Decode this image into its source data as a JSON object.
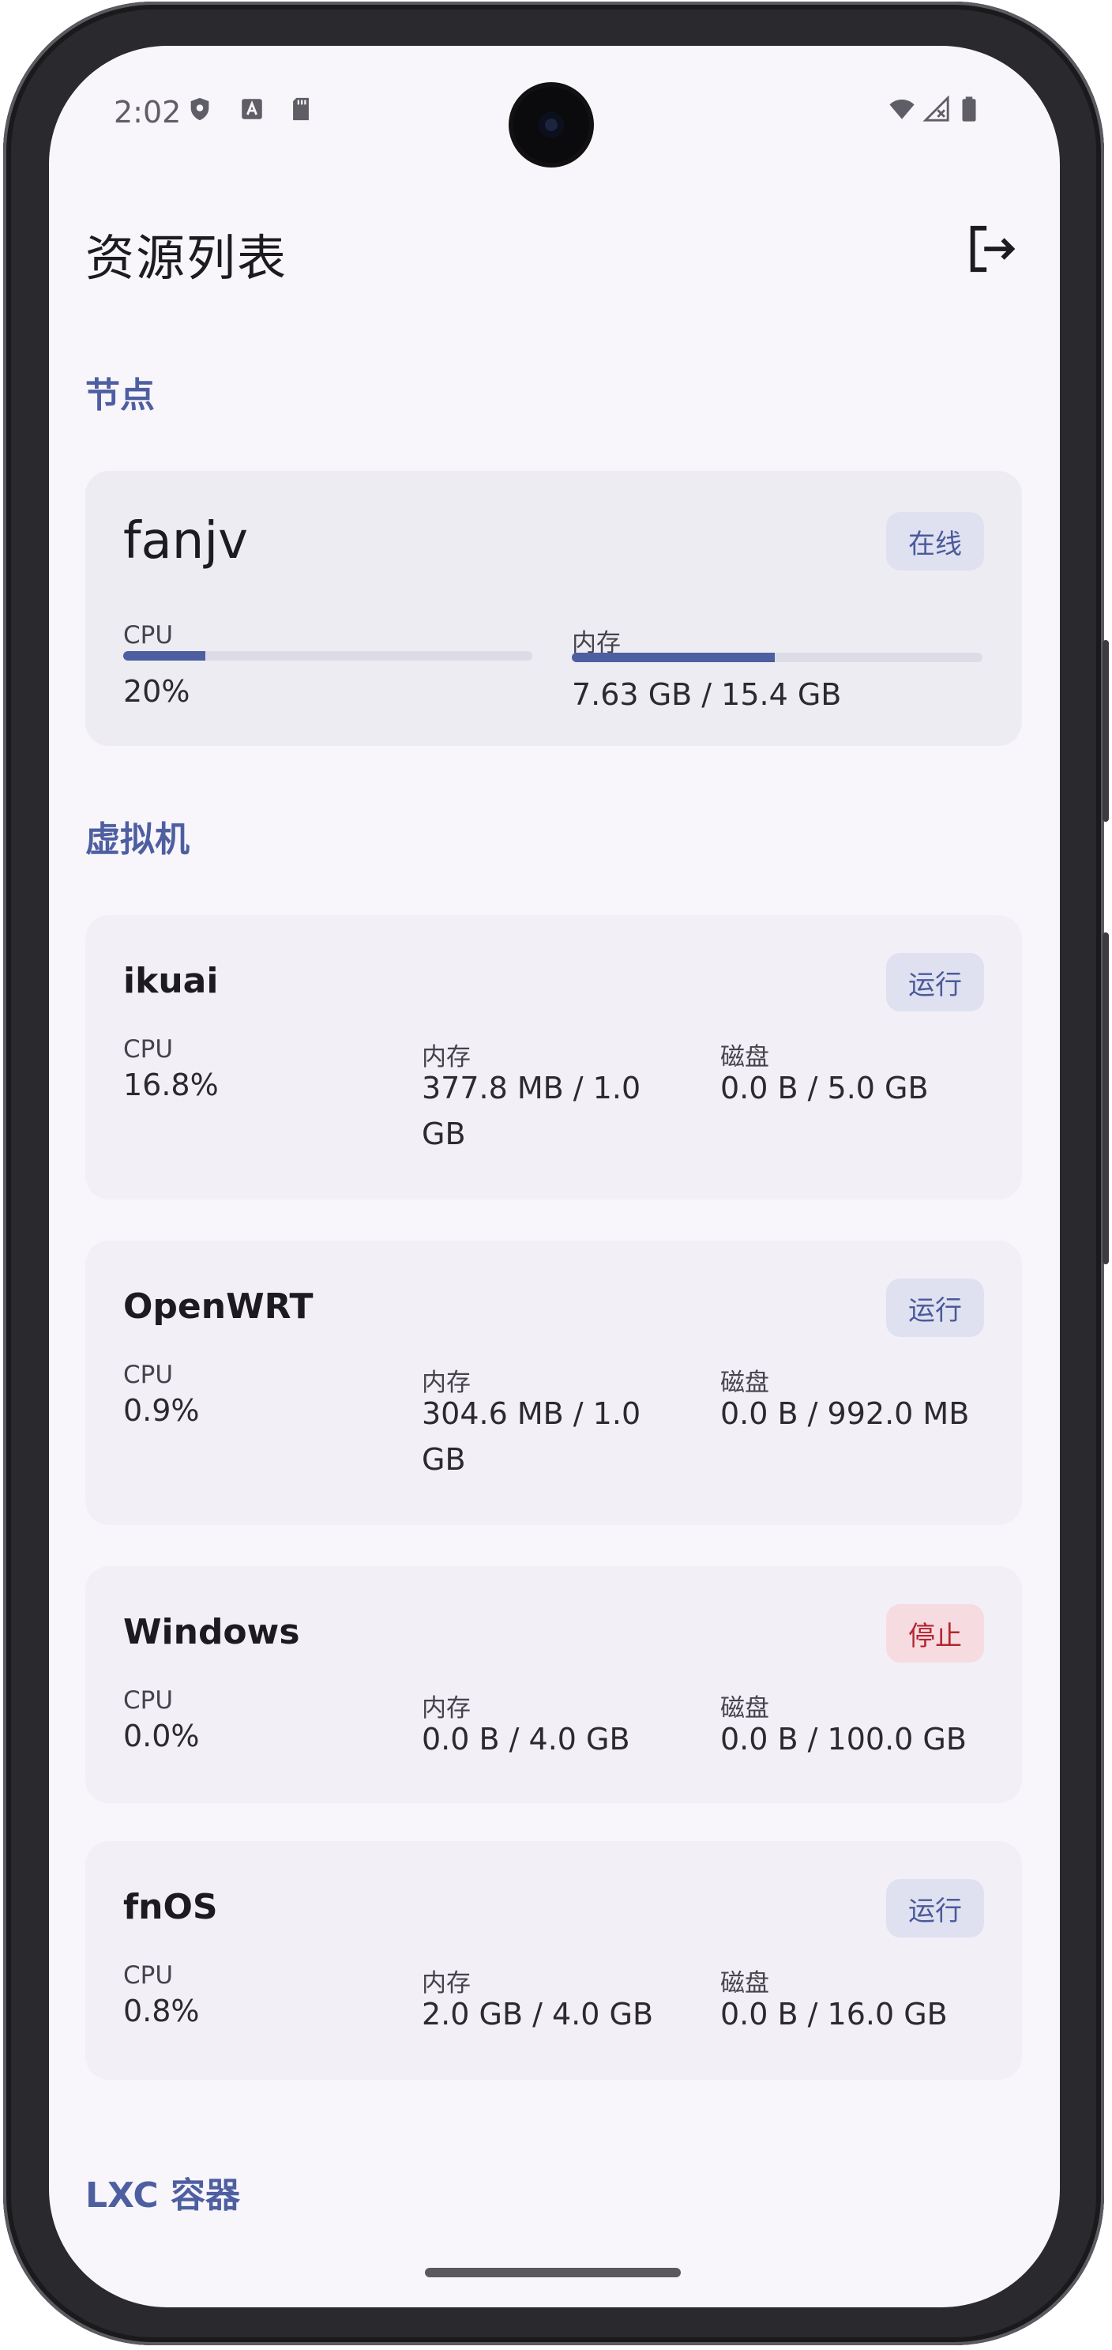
{
  "status_bar": {
    "time": "2:02",
    "icons": [
      "shield-icon",
      "text-a-icon",
      "sd-card-icon",
      "wifi-icon",
      "signal-icon",
      "battery-icon"
    ]
  },
  "header": {
    "title": "资源列表",
    "logout_icon": "logout-icon"
  },
  "sections": {
    "nodes": "节点",
    "vms": "虚拟机",
    "lxc": "LXC 容器"
  },
  "node": {
    "name": "fanjv",
    "status": "在线",
    "cpu_label": "CPU",
    "cpu_value": "20%",
    "cpu_fraction": 0.2,
    "mem_label": "内存",
    "mem_value": "7.63 GB / 15.4 GB",
    "mem_fraction": 0.495
  },
  "vms": [
    {
      "name": "ikuai",
      "status": "运行",
      "cpu_label": "CPU",
      "cpu": "16.8%",
      "mem_label": "内存",
      "mem": "377.8 MB / 1.0 GB",
      "disk_label": "磁盘",
      "disk": "0.0 B / 5.0 GB"
    },
    {
      "name": "OpenWRT",
      "status": "运行",
      "cpu_label": "CPU",
      "cpu": "0.9%",
      "mem_label": "内存",
      "mem": "304.6 MB / 1.0 GB",
      "disk_label": "磁盘",
      "disk": "0.0 B / 992.0 MB"
    },
    {
      "name": "Windows",
      "status": "停止",
      "cpu_label": "CPU",
      "cpu": "0.0%",
      "mem_label": "内存",
      "mem": "0.0 B / 4.0 GB",
      "disk_label": "磁盘",
      "disk": "0.0 B / 100.0 GB"
    },
    {
      "name": "fnOS",
      "status": "运行",
      "cpu_label": "CPU",
      "cpu": "0.8%",
      "mem_label": "内存",
      "mem": "2.0 GB / 4.0 GB",
      "disk_label": "磁盘",
      "disk": "0.0 B / 16.0 GB"
    }
  ],
  "colors": {
    "accent": "#4e5fa1",
    "running_badge": "#dfe1f0",
    "stopped_badge": "#f6dbe0",
    "stopped_text": "#b3262e"
  }
}
